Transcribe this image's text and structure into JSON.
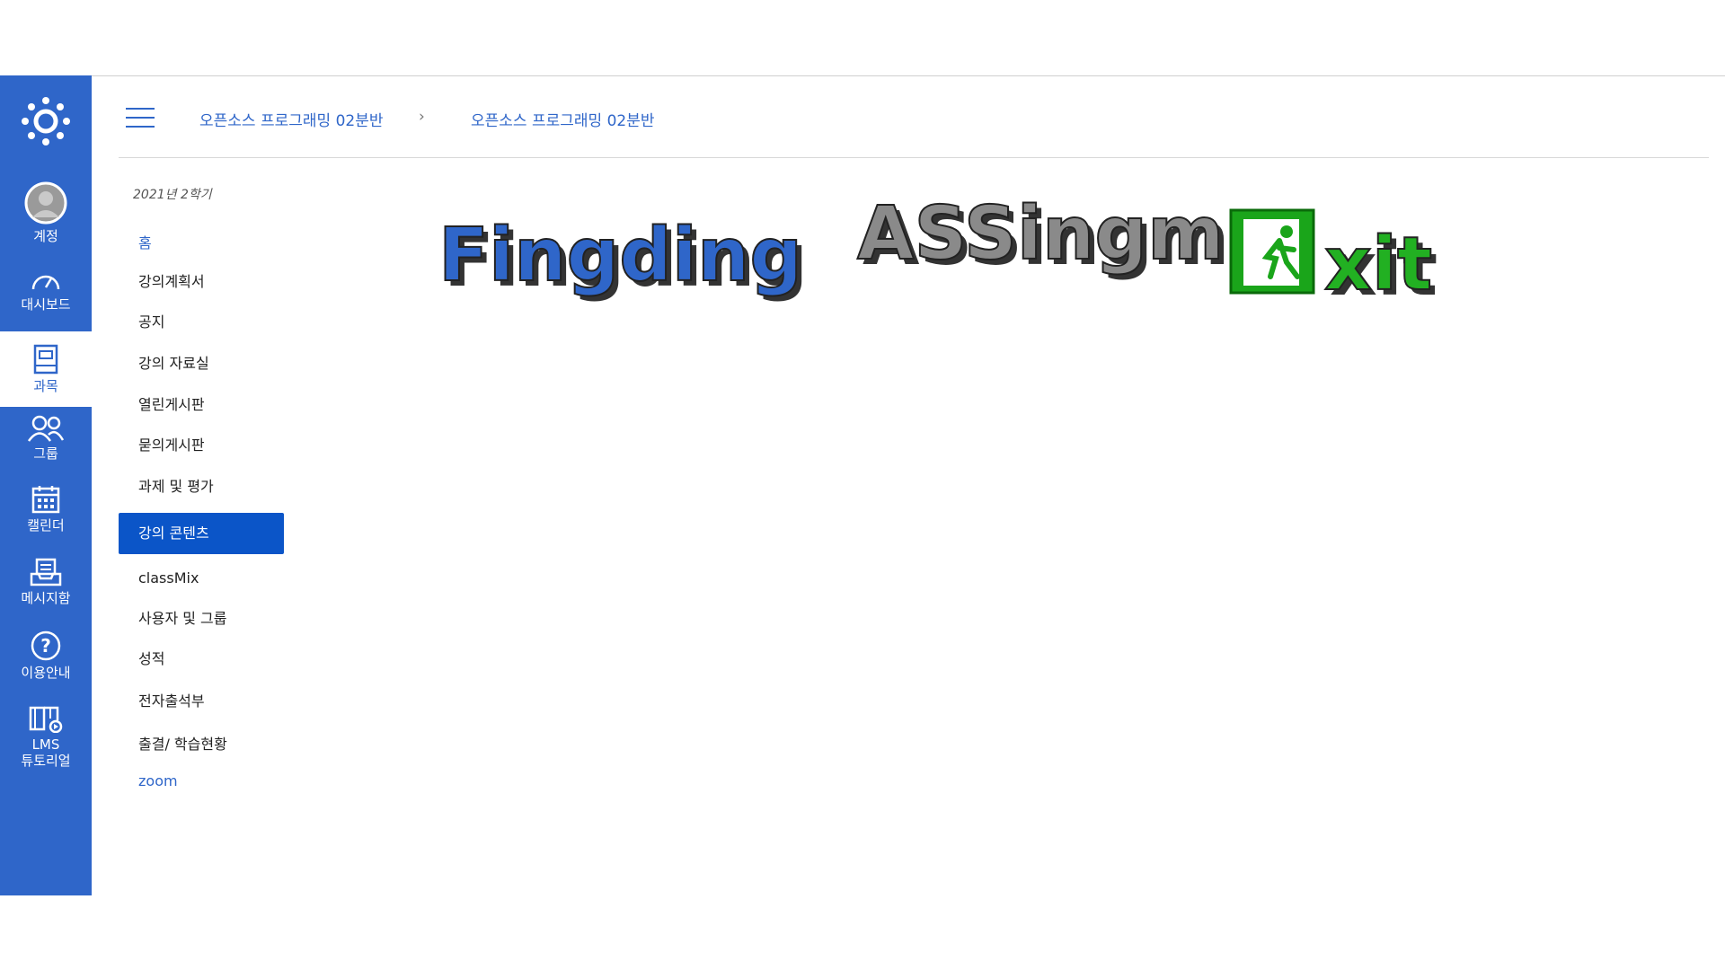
{
  "nav": {
    "items": [
      {
        "label": "계정",
        "icon": "account-avatar-icon"
      },
      {
        "label": "대시보드",
        "icon": "dashboard-icon"
      },
      {
        "label": "과목",
        "icon": "courses-icon",
        "active": true
      },
      {
        "label": "그룹",
        "icon": "groups-icon"
      },
      {
        "label": "캘린더",
        "icon": "calendar-icon"
      },
      {
        "label": "메시지함",
        "icon": "inbox-icon"
      },
      {
        "label": "이용안내",
        "icon": "help-icon"
      },
      {
        "label": "LMS\n튜토리얼",
        "icon": "tutorial-icon"
      }
    ]
  },
  "breadcrumb": {
    "course": "오픈소스 프로그래밍 02분반",
    "current": "오픈소스 프로그래밍 02분반",
    "separator": "›"
  },
  "course_nav": {
    "term": "2021년 2학기",
    "items": [
      {
        "label": "홈",
        "style": "link"
      },
      {
        "label": "강의계획서"
      },
      {
        "label": "공지"
      },
      {
        "label": "강의 자료실"
      },
      {
        "label": "열린게시판"
      },
      {
        "label": "묻의게시판"
      },
      {
        "label": "과제 및 평가"
      },
      {
        "label": "강의 콘텐츠",
        "active": true
      },
      {
        "label": "classMix"
      },
      {
        "label": "사용자 및 그룹"
      },
      {
        "label": "성적"
      },
      {
        "label": "전자출석부"
      },
      {
        "label": "출결/ 학습현황"
      },
      {
        "label": "zoom",
        "style": "link"
      }
    ]
  },
  "banner": {
    "text": "FingdingASSingmExit",
    "parts": [
      {
        "text": "Fingding",
        "color": "#2f66c9"
      },
      {
        "text": "ASSingm",
        "color": "#8a8a8a"
      },
      {
        "text": "xit",
        "color": "#22b022"
      }
    ],
    "exit_sign_color": "#1aa51a"
  },
  "colors": {
    "nav_bg": "#2f66c9",
    "active_item_bg": "#0b55c8",
    "link": "#2f66c9"
  }
}
